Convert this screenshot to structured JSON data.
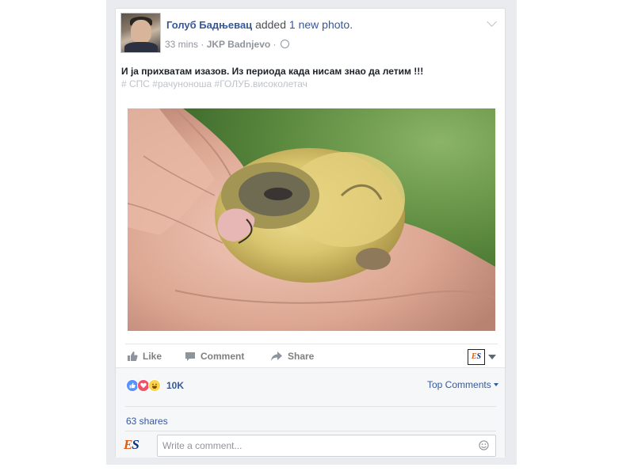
{
  "post": {
    "author": "Голуб Бадњевац",
    "action_text": "added",
    "action_link": "1 new photo.",
    "time": "33 mins",
    "separator": "·",
    "location": "JKP Badnjevo",
    "location_separator": "·",
    "text": "И ја прихватам изазов. Из периода када нисам знао да летим !!!",
    "hashtags": "# СПС #рачуноноша #ГОЛУБ.високолетач",
    "photo_icon": "baby-pigeon-in-hand-photo"
  },
  "actions": {
    "like": "Like",
    "comment": "Comment",
    "share": "Share",
    "page_badge_e": "E",
    "page_badge_s": "S"
  },
  "reactions": {
    "types": [
      "like",
      "love",
      "haha"
    ],
    "count": "10K",
    "sort_label": "Top Comments"
  },
  "shares": "63 shares",
  "comment_input": {
    "avatar_e": "E",
    "avatar_s": "S",
    "placeholder": "Write a comment..."
  },
  "colors": {
    "link": "#365899",
    "muted": "#90949c",
    "like": "#5890ff",
    "love": "#f25268",
    "haha": "#fcd34d"
  }
}
